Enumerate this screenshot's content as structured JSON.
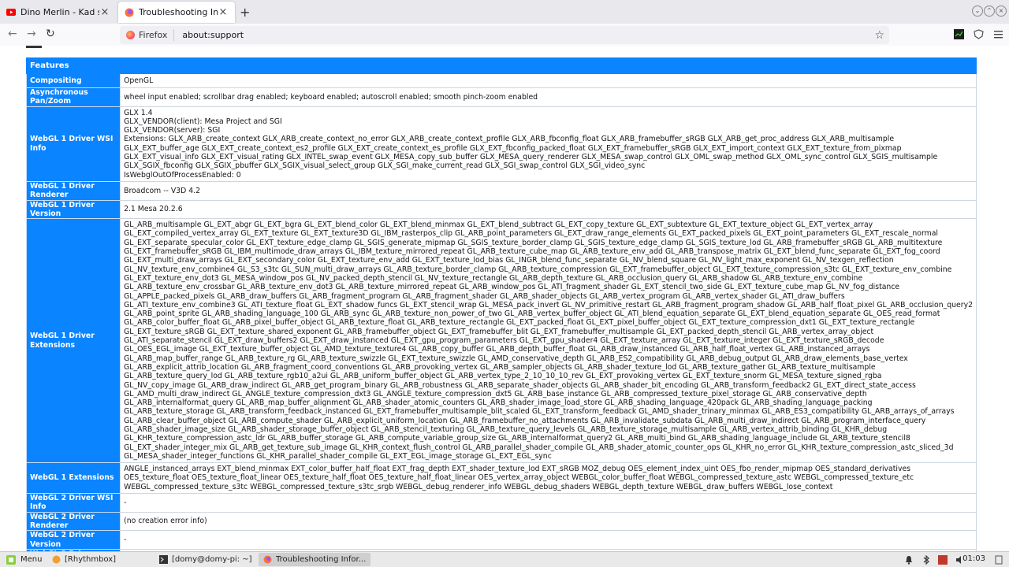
{
  "browser": {
    "tabs": [
      {
        "label": "Dino Merlin - Kad si rekla",
        "icon": "youtube-icon",
        "close": "×"
      },
      {
        "label": "Troubleshooting Informa",
        "icon": "firefox-icon",
        "close": "×"
      }
    ],
    "new_tab": "+",
    "url_identity": "Firefox",
    "url": "about:support",
    "bookmark_star": "☆",
    "back": "←",
    "forward": "→",
    "reload": "↻"
  },
  "features": {
    "heading": "Features",
    "rows": [
      {
        "key": "Compositing",
        "value": "OpenGL"
      },
      {
        "key": "Asynchronous Pan/Zoom",
        "value": "wheel input enabled; scrollbar drag enabled; keyboard enabled; autoscroll enabled; smooth pinch-zoom enabled"
      },
      {
        "key": "WebGL 1 Driver WSI Info",
        "lines": [
          "GLX 1.4",
          "GLX_VENDOR(client): Mesa Project and SGI",
          "GLX_VENDOR(server): SGI",
          "Extensions: GLX_ARB_create_context GLX_ARB_create_context_no_error GLX_ARB_create_context_profile GLX_ARB_fbconfig_float GLX_ARB_framebuffer_sRGB GLX_ARB_get_proc_address GLX_ARB_multisample",
          "GLX_EXT_buffer_age GLX_EXT_create_context_es2_profile GLX_EXT_create_context_es_profile GLX_EXT_fbconfig_packed_float GLX_EXT_framebuffer_sRGB GLX_EXT_import_context GLX_EXT_texture_from_pixmap",
          "GLX_EXT_visual_info GLX_EXT_visual_rating GLX_INTEL_swap_event GLX_MESA_copy_sub_buffer GLX_MESA_query_renderer GLX_MESA_swap_control GLX_OML_swap_method GLX_OML_sync_control GLX_SGIS_multisample",
          "GLX_SGIX_fbconfig GLX_SGIX_pbuffer GLX_SGIX_visual_select_group GLX_SGI_make_current_read GLX_SGI_swap_control GLX_SGI_video_sync",
          "IsWebglOutOfProcessEnabled: 0"
        ]
      },
      {
        "key": "WebGL 1 Driver Renderer",
        "value": "Broadcom -- V3D 4.2"
      },
      {
        "key": "WebGL 1 Driver Version",
        "value": "2.1 Mesa 20.2.6"
      },
      {
        "key": "WebGL 1 Driver Extensions",
        "lines": [
          "GL_ARB_multisample GL_EXT_abgr GL_EXT_bgra GL_EXT_blend_color GL_EXT_blend_minmax GL_EXT_blend_subtract GL_EXT_copy_texture GL_EXT_subtexture GL_EXT_texture_object GL_EXT_vertex_array",
          "GL_EXT_compiled_vertex_array GL_EXT_texture GL_EXT_texture3D GL_IBM_rasterpos_clip GL_ARB_point_parameters GL_EXT_draw_range_elements GL_EXT_packed_pixels GL_EXT_point_parameters GL_EXT_rescale_normal",
          "GL_EXT_separate_specular_color GL_EXT_texture_edge_clamp GL_SGIS_generate_mipmap GL_SGIS_texture_border_clamp GL_SGIS_texture_edge_clamp GL_SGIS_texture_lod GL_ARB_framebuffer_sRGB GL_ARB_multitexture",
          "GL_EXT_framebuffer_sRGB GL_IBM_multimode_draw_arrays GL_IBM_texture_mirrored_repeat GL_ARB_texture_cube_map GL_ARB_texture_env_add GL_ARB_transpose_matrix GL_EXT_blend_func_separate GL_EXT_fog_coord",
          "GL_EXT_multi_draw_arrays GL_EXT_secondary_color GL_EXT_texture_env_add GL_EXT_texture_lod_bias GL_INGR_blend_func_separate GL_NV_blend_square GL_NV_light_max_exponent GL_NV_texgen_reflection",
          "GL_NV_texture_env_combine4 GL_S3_s3tc GL_SUN_multi_draw_arrays GL_ARB_texture_border_clamp GL_ARB_texture_compression GL_EXT_framebuffer_object GL_EXT_texture_compression_s3tc GL_EXT_texture_env_combine",
          "GL_EXT_texture_env_dot3 GL_MESA_window_pos GL_NV_packed_depth_stencil GL_NV_texture_rectangle GL_ARB_depth_texture GL_ARB_occlusion_query GL_ARB_shadow GL_ARB_texture_env_combine",
          "GL_ARB_texture_env_crossbar GL_ARB_texture_env_dot3 GL_ARB_texture_mirrored_repeat GL_ARB_window_pos GL_ATI_fragment_shader GL_EXT_stencil_two_side GL_EXT_texture_cube_map GL_NV_fog_distance",
          "GL_APPLE_packed_pixels GL_ARB_draw_buffers GL_ARB_fragment_program GL_ARB_fragment_shader GL_ARB_shader_objects GL_ARB_vertex_program GL_ARB_vertex_shader GL_ATI_draw_buffers",
          "GL_ATI_texture_env_combine3 GL_ATI_texture_float GL_EXT_shadow_funcs GL_EXT_stencil_wrap GL_MESA_pack_invert GL_NV_primitive_restart GL_ARB_fragment_program_shadow GL_ARB_half_float_pixel GL_ARB_occlusion_query2",
          "GL_ARB_point_sprite GL_ARB_shading_language_100 GL_ARB_sync GL_ARB_texture_non_power_of_two GL_ARB_vertex_buffer_object GL_ATI_blend_equation_separate GL_EXT_blend_equation_separate GL_OES_read_format",
          "GL_ARB_color_buffer_float GL_ARB_pixel_buffer_object GL_ARB_texture_float GL_ARB_texture_rectangle GL_EXT_packed_float GL_EXT_pixel_buffer_object GL_EXT_texture_compression_dxt1 GL_EXT_texture_rectangle",
          "GL_EXT_texture_sRGB GL_EXT_texture_shared_exponent GL_ARB_framebuffer_object GL_EXT_framebuffer_blit GL_EXT_framebuffer_multisample GL_EXT_packed_depth_stencil GL_ARB_vertex_array_object",
          "GL_ATI_separate_stencil GL_EXT_draw_buffers2 GL_EXT_draw_instanced GL_EXT_gpu_program_parameters GL_EXT_gpu_shader4 GL_EXT_texture_array GL_EXT_texture_integer GL_EXT_texture_sRGB_decode",
          "GL_OES_EGL_image GL_EXT_texture_buffer_object GL_AMD_texture_texture4 GL_ARB_copy_buffer GL_ARB_depth_buffer_float GL_ARB_draw_instanced GL_ARB_half_float_vertex GL_ARB_instanced_arrays",
          "GL_ARB_map_buffer_range GL_ARB_texture_rg GL_ARB_texture_swizzle GL_EXT_texture_swizzle GL_AMD_conservative_depth GL_ARB_ES2_compatibility GL_ARB_debug_output GL_ARB_draw_elements_base_vertex",
          "GL_ARB_explicit_attrib_location GL_ARB_fragment_coord_conventions GL_ARB_provoking_vertex GL_ARB_sampler_objects GL_ARB_shader_texture_lod GL_ARB_texture_gather GL_ARB_texture_multisample",
          "GL_ARB_texture_query_lod GL_ARB_texture_rgb10_a2ui GL_ARB_uniform_buffer_object GL_ARB_vertex_type_2_10_10_10_rev GL_EXT_provoking_vertex GL_EXT_texture_snorm GL_MESA_texture_signed_rgba",
          "GL_NV_copy_image GL_ARB_draw_indirect GL_ARB_get_program_binary GL_ARB_robustness GL_ARB_separate_shader_objects GL_ARB_shader_bit_encoding GL_ARB_transform_feedback2 GL_EXT_direct_state_access",
          "GL_AMD_multi_draw_indirect GL_ANGLE_texture_compression_dxt3 GL_ANGLE_texture_compression_dxt5 GL_ARB_base_instance GL_ARB_compressed_texture_pixel_storage GL_ARB_conservative_depth",
          "GL_ARB_internalformat_query GL_ARB_map_buffer_alignment GL_ARB_shader_atomic_counters GL_ARB_shader_image_load_store GL_ARB_shading_language_420pack GL_ARB_shading_language_packing",
          "GL_ARB_texture_storage GL_ARB_transform_feedback_instanced GL_EXT_framebuffer_multisample_blit_scaled GL_EXT_transform_feedback GL_AMD_shader_trinary_minmax GL_ARB_ES3_compatibility GL_ARB_arrays_of_arrays",
          "GL_ARB_clear_buffer_object GL_ARB_compute_shader GL_ARB_explicit_uniform_location GL_ARB_framebuffer_no_attachments GL_ARB_invalidate_subdata GL_ARB_multi_draw_indirect GL_ARB_program_interface_query",
          "GL_ARB_shader_image_size GL_ARB_shader_storage_buffer_object GL_ARB_stencil_texturing GL_ARB_texture_query_levels GL_ARB_texture_storage_multisample GL_ARB_vertex_attrib_binding GL_KHR_debug",
          "GL_KHR_texture_compression_astc_ldr GL_ARB_buffer_storage GL_ARB_compute_variable_group_size GL_ARB_internalformat_query2 GL_ARB_multi_bind GL_ARB_shading_language_include GL_ARB_texture_stencil8",
          "GL_EXT_shader_integer_mix GL_ARB_get_texture_sub_image GL_KHR_context_flush_control GL_ARB_parallel_shader_compile GL_ARB_shader_atomic_counter_ops GL_KHR_no_error GL_KHR_texture_compression_astc_sliced_3d",
          "GL_MESA_shader_integer_functions GL_KHR_parallel_shader_compile GL_EXT_EGL_image_storage GL_EXT_EGL_sync"
        ]
      },
      {
        "key": "WebGL 1 Extensions",
        "lines": [
          "ANGLE_instanced_arrays EXT_blend_minmax EXT_color_buffer_half_float EXT_frag_depth EXT_shader_texture_lod EXT_sRGB MOZ_debug OES_element_index_uint OES_fbo_render_mipmap OES_standard_derivatives",
          "OES_texture_float OES_texture_float_linear OES_texture_half_float OES_texture_half_float_linear OES_vertex_array_object WEBGL_color_buffer_float WEBGL_compressed_texture_astc WEBGL_compressed_texture_etc",
          "WEBGL_compressed_texture_s3tc WEBGL_compressed_texture_s3tc_srgb WEBGL_debug_renderer_info WEBGL_debug_shaders WEBGL_depth_texture WEBGL_draw_buffers WEBGL_lose_context"
        ]
      },
      {
        "key": "WebGL 2 Driver WSI Info",
        "value": "-"
      },
      {
        "key": "WebGL 2 Driver Renderer",
        "value": "(no creation error info)"
      },
      {
        "key": "WebGL 2 Driver Version",
        "value": "-"
      },
      {
        "key": "WebGL 2 Driver Extensions",
        "value": "-"
      },
      {
        "key": "WebGL 2 Extensions",
        "value": "-"
      }
    ]
  },
  "taskbar": {
    "menu": "Menu",
    "tasks": [
      {
        "label": "[Rhythmbox]",
        "icon": "music-icon"
      },
      {
        "label": "[domy@domy-pi: ~]",
        "icon": "terminal-icon"
      },
      {
        "label": "Troubleshooting Infor...",
        "icon": "firefox-icon",
        "active": true
      }
    ],
    "clock": "01:03"
  }
}
